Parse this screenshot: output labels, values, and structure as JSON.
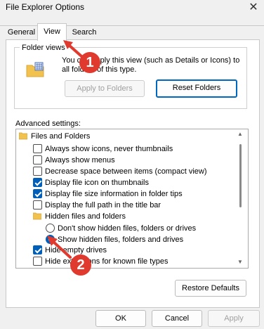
{
  "window": {
    "title": "File Explorer Options",
    "close_glyph": "✕"
  },
  "tabs": [
    {
      "label": "General"
    },
    {
      "label": "View"
    },
    {
      "label": "Search"
    }
  ],
  "folder_views": {
    "label": "Folder views",
    "text": "You can apply this view (such as Details or Icons) to all folders of this type.",
    "apply_button": "Apply to Folders",
    "reset_button": "Reset Folders"
  },
  "advanced": {
    "label": "Advanced settings:",
    "items": [
      {
        "label": "Files and Folders",
        "kind": "folder"
      },
      {
        "label": "Always show icons, never thumbnails",
        "kind": "checkbox",
        "checked": false
      },
      {
        "label": "Always show menus",
        "kind": "checkbox",
        "checked": false
      },
      {
        "label": "Decrease space between items (compact view)",
        "kind": "checkbox",
        "checked": false
      },
      {
        "label": "Display file icon on thumbnails",
        "kind": "checkbox",
        "checked": true
      },
      {
        "label": "Display file size information in folder tips",
        "kind": "checkbox",
        "checked": true
      },
      {
        "label": "Display the full path in the title bar",
        "kind": "checkbox",
        "checked": false
      },
      {
        "label": "Hidden files and folders",
        "kind": "folder"
      },
      {
        "label": "Don't show hidden files, folders or drives",
        "kind": "radio",
        "checked": false
      },
      {
        "label": "Show hidden files, folders and drives",
        "kind": "radio",
        "checked": true
      },
      {
        "label": "Hide empty drives",
        "kind": "checkbox",
        "checked": true
      },
      {
        "label": "Hide extensions for known file types",
        "kind": "checkbox",
        "checked": false
      }
    ],
    "restore_button": "Restore Defaults"
  },
  "footer": {
    "ok": "OK",
    "cancel": "Cancel",
    "apply": "Apply"
  },
  "annotations": [
    {
      "number": "1"
    },
    {
      "number": "2"
    }
  ],
  "colors": {
    "accent": "#005fb8",
    "badge": "#e03a2f"
  }
}
